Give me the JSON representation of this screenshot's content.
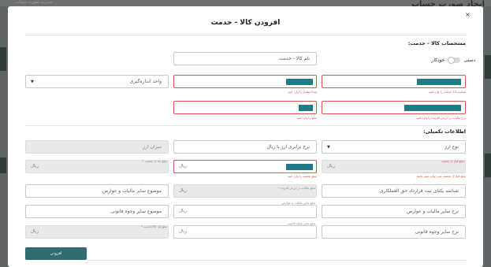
{
  "background": {
    "title": "ایجاد صورت حساب",
    "nav_text": "مدیریت صورت حساب"
  },
  "modal": {
    "title": "افزودن کالا - خدمت",
    "close_icon": "×"
  },
  "section1": {
    "title": "مشخصات کالا - خدمت:",
    "toggle_label_left": "خودکار",
    "toggle_label_right": "دستی",
    "service_name_placeholder": "نام کالا - خدمت",
    "unit_placeholder": "واحد اندازه‌گیری",
    "error_shenase": "شناسه 13 خدمت را وارد کنید",
    "error_count": "تعداد/مقدار را وارد کنید",
    "error_tax": "نرخ مالیات بر ارزش افزوده را وارد کنید",
    "error_fee": "مبلغ را وارد کنید"
  },
  "section2": {
    "title": "اطلاعات تکمیلی:",
    "currency_type_placeholder": "نوع ارز",
    "exchange_rate_placeholder": "نرخ برابری ارز با ریال",
    "currency_amount_placeholder": "میزان ارز",
    "label_before_discount": "مبلغ قبل از تخفیف",
    "error_before_discount": "مبلغ قبل از تخفیف نمی تواند صفر باشد",
    "rial": "ریال",
    "label_discount": "مبلغ تخفیف",
    "error_discount": "مبلغ تخفیف را وارد کنید",
    "label_after_discount": "مبلغ بعد از تخفیف *",
    "contract_id_placeholder": "شناسه یکتای ثبت قرارداد حق العملکاری",
    "label_vat": "مبلغ مالیات بر ارزش افزوده *",
    "other_tax_subject_placeholder": "موضوع سایر مالیات و عوارض",
    "other_tax_rate_placeholder": "نرخ سایر مالیات و عوارض",
    "label_other_tax_amount": "مبلغ سایر مالیات و عوارض",
    "legal_subject_placeholder": "موضوع سایر وجوه قانونی",
    "legal_rate_placeholder": "نرخ سایر وجوه قانونی",
    "label_legal_amount": "مبلغ سایر وجوه قانونی",
    "label_total": "مبلغ کل کالا/خدمت *"
  },
  "footer": {
    "submit_label": "افزودن"
  }
}
